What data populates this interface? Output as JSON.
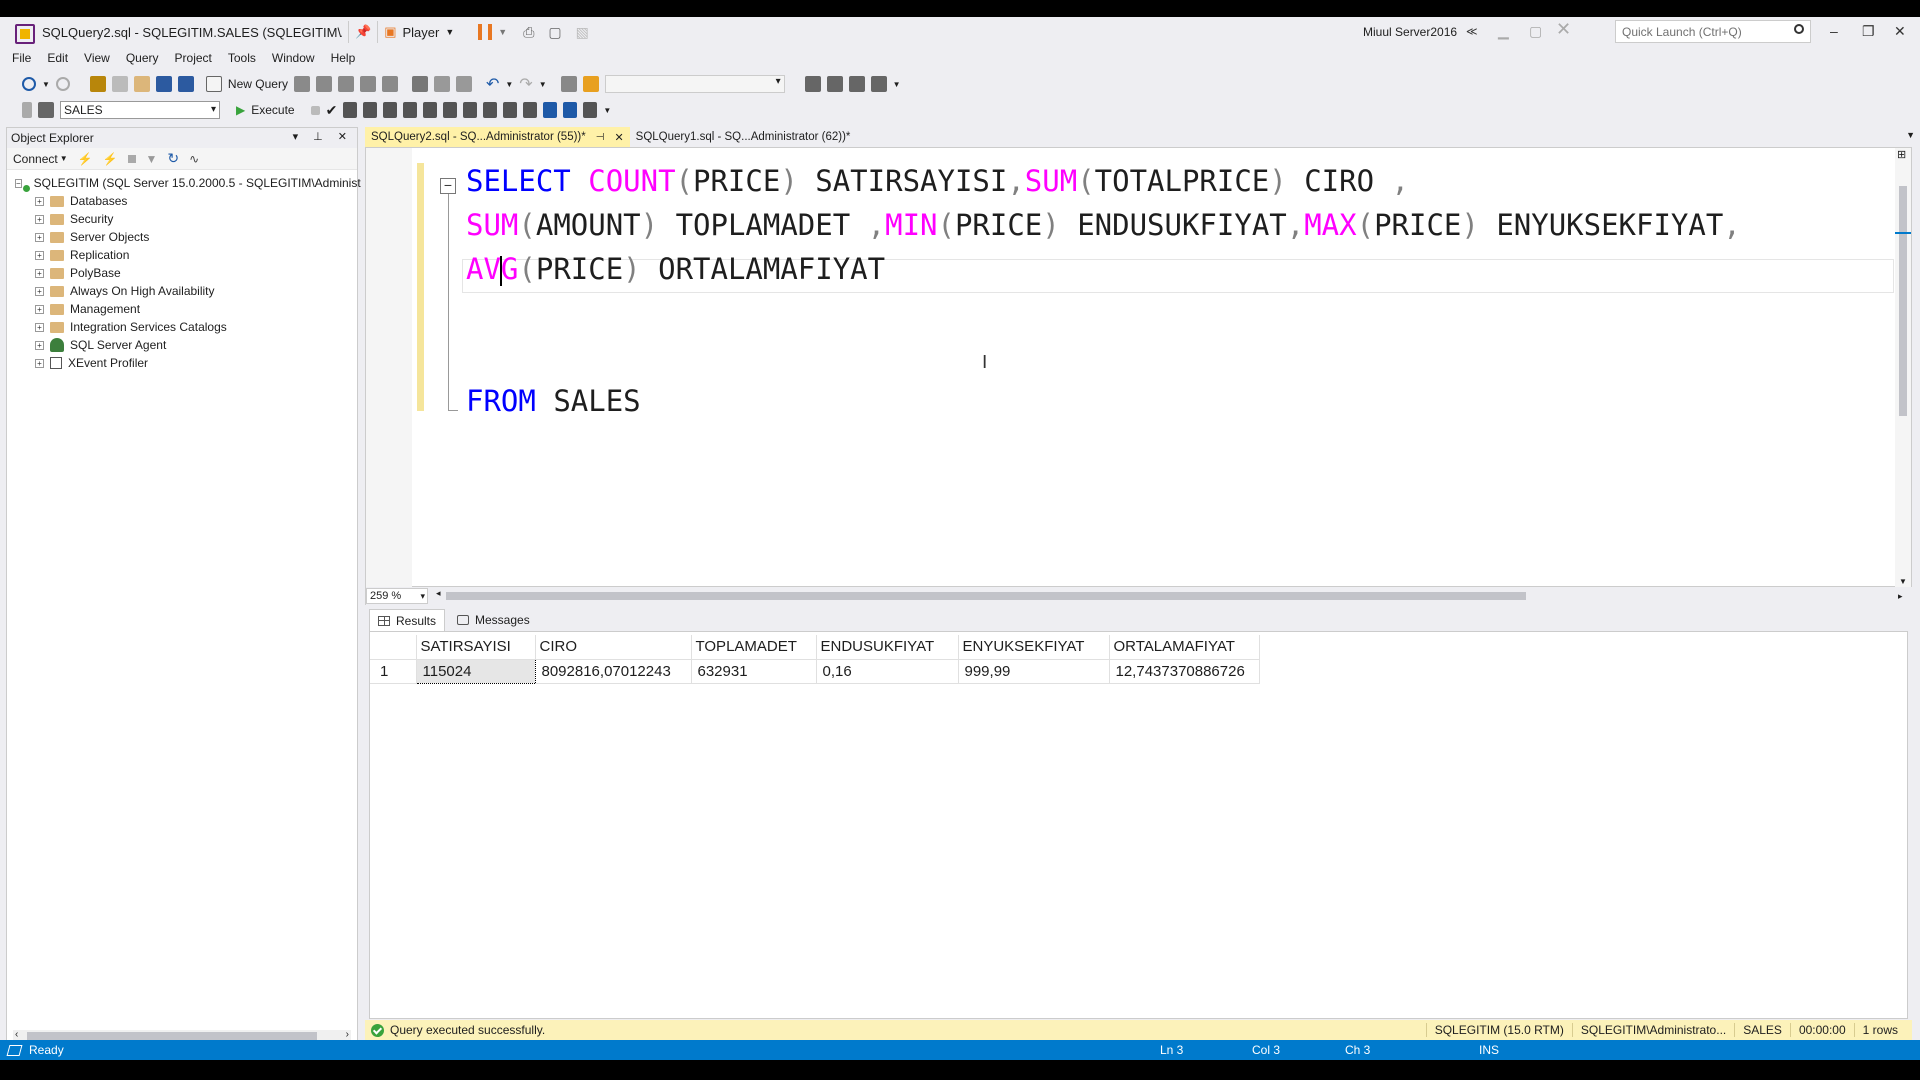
{
  "window": {
    "title": "SQLQuery2.sql - SQLEGITIM.SALES (SQLEGITIM\\Admini",
    "quick_launch_placeholder": "Quick Launch (Ctrl+Q)"
  },
  "vm": {
    "player_label": "Player",
    "name": "Miuul Server2016"
  },
  "menu": [
    "File",
    "Edit",
    "View",
    "Query",
    "Project",
    "Tools",
    "Window",
    "Help"
  ],
  "toolbar": {
    "new_query": "New Query",
    "database": "SALES",
    "execute": "Execute"
  },
  "object_explorer": {
    "title": "Object Explorer",
    "connect_label": "Connect",
    "server": "SQLEGITIM (SQL Server 15.0.2000.5 - SQLEGITIM\\Administ",
    "nodes": [
      "Databases",
      "Security",
      "Server Objects",
      "Replication",
      "PolyBase",
      "Always On High Availability",
      "Management",
      "Integration Services Catalogs",
      "SQL Server Agent",
      "XEvent Profiler"
    ]
  },
  "editor": {
    "tabs": [
      "SQLQuery2.sql - SQ...Administrator (55))*",
      "SQLQuery1.sql - SQ...Administrator (62))*"
    ],
    "zoom": "259 %",
    "code": {
      "select": "SELECT",
      "count": "COUNT",
      "price": "PRICE",
      "alias_satir": "SATIRSAYISI",
      "sum": "SUM",
      "totalprice": "TOTALPRICE",
      "alias_ciro": "CIRO",
      "amount": "AMOUNT",
      "alias_toplam": "TOPLAMADET",
      "min": "MIN",
      "alias_min": "ENDUSUKFIYAT",
      "max": "MAX",
      "alias_max": "ENYUKSEKFIYAT",
      "avg_a": "AV",
      "avg_b": "G",
      "alias_avg": "ORTALAMAFIYAT",
      "from": "FROM",
      "table": "SALES"
    }
  },
  "results": {
    "tabs": [
      "Results",
      "Messages"
    ],
    "columns": [
      "SATIRSAYISI",
      "CIRO",
      "TOPLAMADET",
      "ENDUSUKFIYAT",
      "ENYUKSEKFIYAT",
      "ORTALAMAFIYAT"
    ],
    "rows": [
      [
        "1",
        "115024",
        "8092816,07012243",
        "632931",
        "0,16",
        "999,99",
        "12,7437370886726"
      ]
    ]
  },
  "query_status": {
    "message": "Query executed successfully.",
    "server": "SQLEGITIM (15.0 RTM)",
    "user": "SQLEGITIM\\Administrato...",
    "database": "SALES",
    "time": "00:00:00",
    "rows": "1 rows"
  },
  "status": {
    "ready": "Ready",
    "ln": "Ln 3",
    "col": "Col 3",
    "ch": "Ch 3",
    "mode": "INS"
  }
}
